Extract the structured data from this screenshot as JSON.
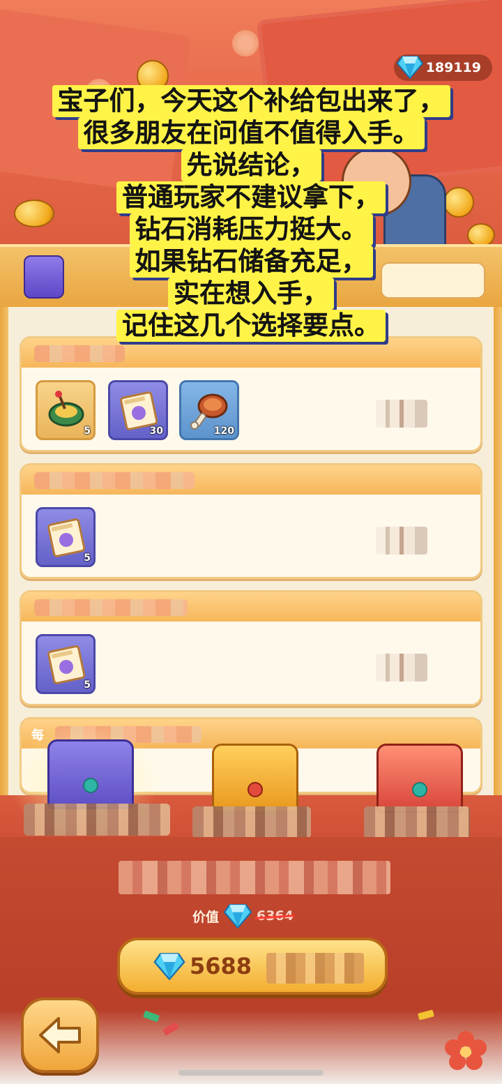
{
  "header": {
    "diamond_count": "189119",
    "diamond_icon": "diamond-icon"
  },
  "caption": {
    "lines": [
      "宝子们，今天这个补给包出来了，",
      "很多朋友在问值不值得入手。",
      "先说结论，",
      "普通玩家不建议拿下，",
      "钻石消耗压力挺大。",
      "如果钻石储备充足，",
      "实在想入手，",
      "记住这几个选择要点。"
    ]
  },
  "rewards": {
    "cards": [
      {
        "items": [
          {
            "icon": "spinning-top-icon",
            "qty": "5"
          },
          {
            "icon": "scroll-ticket-icon",
            "qty": "30"
          },
          {
            "icon": "meat-icon",
            "qty": "120"
          }
        ]
      },
      {
        "items": [
          {
            "icon": "scroll-ticket-icon",
            "qty": "5"
          }
        ]
      },
      {
        "items": [
          {
            "icon": "scroll-ticket-icon",
            "qty": "5"
          }
        ]
      },
      {
        "head_prefix": "每"
      }
    ]
  },
  "purchase": {
    "value_label": "价值",
    "original_price": "6364",
    "price": "5688"
  },
  "colors": {
    "accent_gold": "#f3ae2e",
    "panel_bg": "#f6eed9",
    "caption_bg": "#fff347",
    "background_red": "#d9573a"
  }
}
